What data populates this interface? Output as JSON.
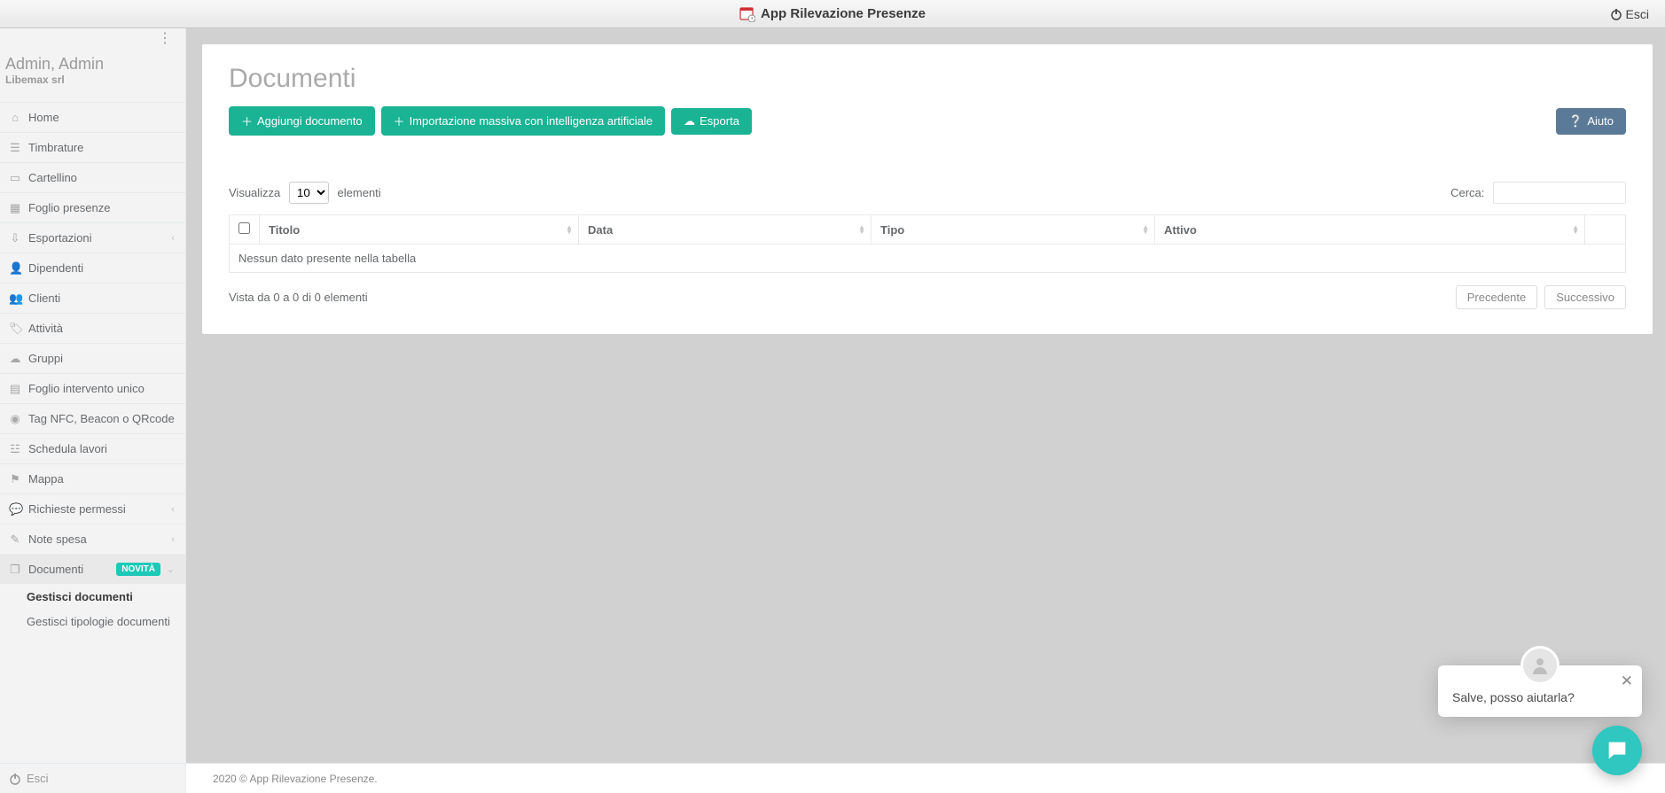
{
  "topbar": {
    "title": "App Rilevazione Presenze",
    "exit": "Esci"
  },
  "user": {
    "name": "Admin, Admin",
    "company": "Libemax srl"
  },
  "sidebar": {
    "items": [
      {
        "icon": "home",
        "label": "Home",
        "chev": false
      },
      {
        "icon": "list",
        "label": "Timbrature",
        "chev": false
      },
      {
        "icon": "id",
        "label": "Cartellino",
        "chev": false
      },
      {
        "icon": "cal",
        "label": "Foglio presenze",
        "chev": false
      },
      {
        "icon": "download",
        "label": "Esportazioni",
        "chev": true
      },
      {
        "icon": "user",
        "label": "Dipendenti",
        "chev": false
      },
      {
        "icon": "users",
        "label": "Clienti",
        "chev": false
      },
      {
        "icon": "tag",
        "label": "Attività",
        "chev": false
      },
      {
        "icon": "cloud",
        "label": "Gruppi",
        "chev": false
      },
      {
        "icon": "doc",
        "label": "Foglio intervento unico",
        "chev": false
      },
      {
        "icon": "nfc",
        "label": "Tag NFC, Beacon o QRcode",
        "chev": false
      },
      {
        "icon": "sched",
        "label": "Schedula lavori",
        "chev": false
      },
      {
        "icon": "map",
        "label": "Mappa",
        "chev": false
      },
      {
        "icon": "chat",
        "label": "Richieste permessi",
        "chev": true
      },
      {
        "icon": "note",
        "label": "Note spesa",
        "chev": true
      }
    ],
    "documents": {
      "label": "Documenti",
      "badge": "NOVITÀ",
      "sub1": "Gestisci documenti",
      "sub2": "Gestisci tipologie documenti"
    },
    "footer_exit": "Esci"
  },
  "page": {
    "title": "Documenti",
    "btn_add": "Aggiungi documento",
    "btn_import": "Importazione massiva con intelligenza artificiale",
    "btn_export": "Esporta",
    "btn_help": "Aiuto"
  },
  "datatable": {
    "length_pre": "Visualizza",
    "length_post": "elementi",
    "length_value": "10",
    "search_label": "Cerca:",
    "cols": {
      "titolo": "Titolo",
      "data": "Data",
      "tipo": "Tipo",
      "attivo": "Attivo"
    },
    "empty": "Nessun dato presente nella tabella",
    "info": "Vista da 0 a 0 di 0 elementi",
    "prev": "Precedente",
    "next": "Successivo"
  },
  "footer": "2020 © App Rilevazione Presenze.",
  "chat": {
    "text": "Salve, posso aiutarla?"
  }
}
